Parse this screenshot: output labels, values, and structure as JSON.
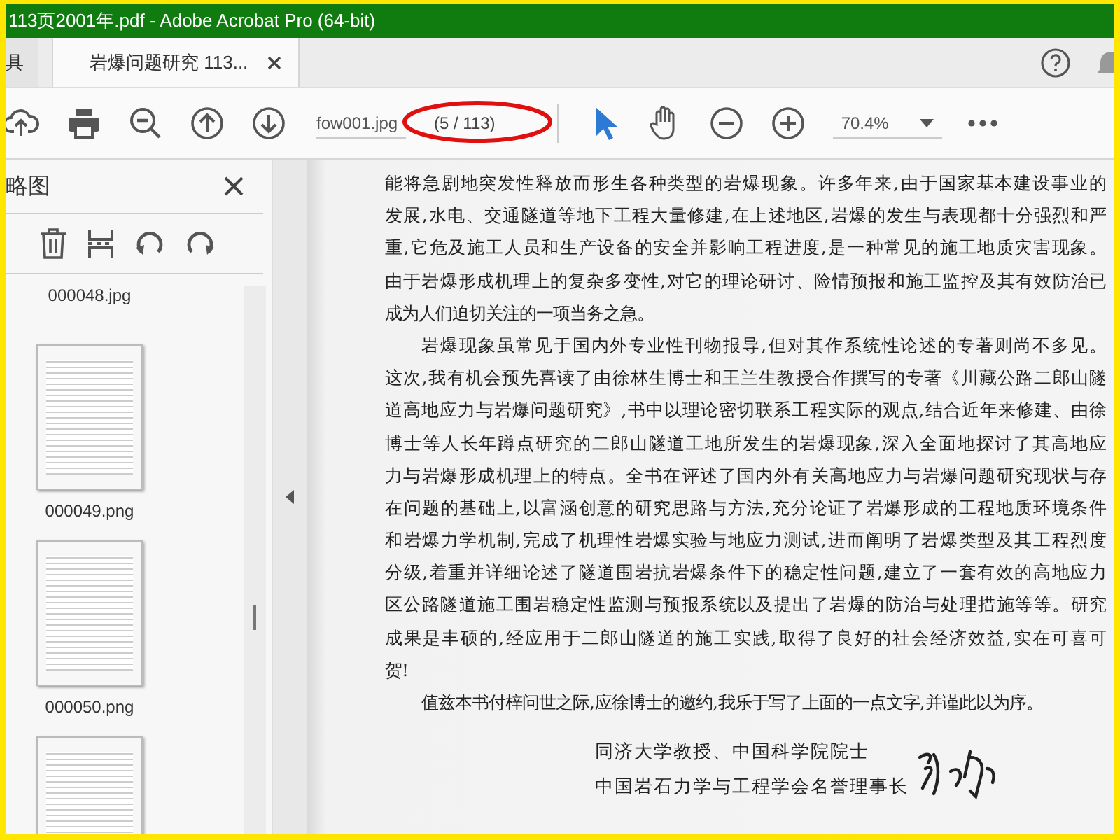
{
  "window": {
    "title": "113页2001年.pdf - Adobe Acrobat Pro (64-bit)"
  },
  "tabs": [
    {
      "label": "具",
      "selected": false,
      "closable": false
    },
    {
      "label": "岩爆问题研究 113...",
      "selected": true,
      "closable": true
    }
  ],
  "toolbar": {
    "file_field": "fow001.jpg",
    "page_indicator": "(5 / 113)",
    "zoom": "70.4%",
    "tools": [
      {
        "kind": "select",
        "selected": true
      },
      {
        "kind": "hand",
        "selected": false
      }
    ]
  },
  "sidebar": {
    "title": "略图",
    "thumbnails": [
      {
        "label": "000048.jpg",
        "kind": "clipped"
      },
      {
        "label": "000049.png",
        "kind": "full"
      },
      {
        "label": "000050.png",
        "kind": "full"
      }
    ]
  },
  "document": {
    "paragraphs": [
      {
        "indent": false,
        "lines": [
          "能将急剧地突发性释放而形生各种类型的岩爆现象。许多年来,由于国家基本建设事业的",
          "发展,水电、交通隧道等地下工程大量修建,在上述地区,岩爆的发生与表现都十分强烈和严",
          "重,它危及施工人员和生产设备的安全并影响工程进度,是一种常见的施工地质灾害现象。",
          "由于岩爆形成机理上的复杂多变性,对它的理论研讨、险情预报和施工监控及其有效防治已",
          "成为人们迫切关注的一项当务之急。"
        ]
      },
      {
        "indent": true,
        "lines": [
          "岩爆现象虽常见于国内外专业性刊物报导,但对其作系统性论述的专著则尚不多见。",
          "这次,我有机会预先喜读了由徐林生博士和王兰生教授合作撰写的专著《川藏公路二郎山隧",
          "道高地应力与岩爆问题研究》,书中以理论密切联系工程实际的观点,结合近年来修建、由徐",
          "博士等人长年蹲点研究的二郎山隧道工地所发生的岩爆现象,深入全面地探讨了其高地应",
          "力与岩爆形成机理上的特点。全书在评述了国内外有关高地应力与岩爆问题研究现状与存",
          "在问题的基础上,以富涵创意的研究思路与方法,充分论证了岩爆形成的工程地质环境条件",
          "和岩爆力学机制,完成了机理性岩爆实验与地应力测试,进而阐明了岩爆类型及其工程烈度",
          "分级,着重并详细论述了隧道围岩抗岩爆条件下的稳定性问题,建立了一套有效的高地应力",
          "区公路隧道施工围岩稳定性监测与预报系统以及提出了岩爆的防治与处理措施等等。研究",
          "成果是丰硕的,经应用于二郎山隧道的施工实践,取得了良好的社会经济效益,实在可喜可",
          "贺!"
        ]
      },
      {
        "indent": true,
        "lines": [
          "值兹本书付梓问世之际,应徐博士的邀约,我乐于写了上面的一点文字,并谨此以为序。"
        ]
      }
    ],
    "signature_lines": [
      "同济大学教授、中国科学院院士",
      "中国岩石力学与工程学会名誉理事长"
    ]
  }
}
